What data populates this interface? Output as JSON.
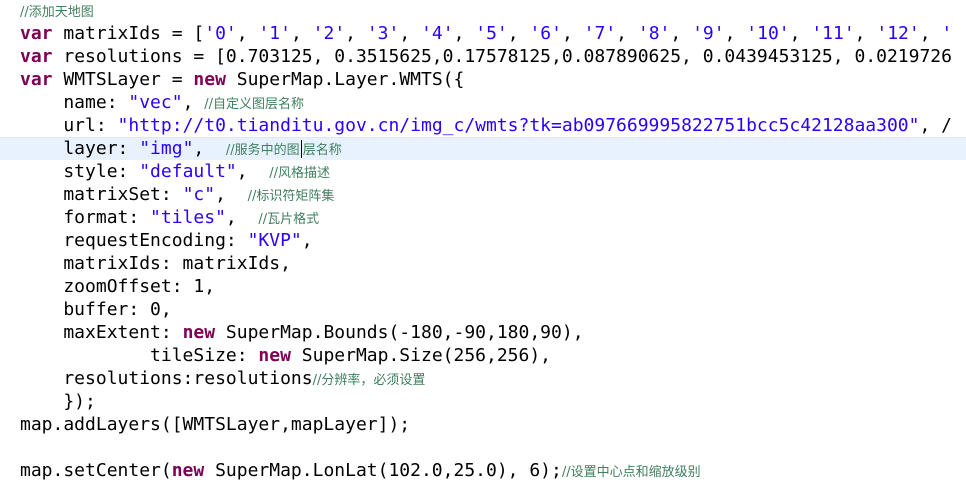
{
  "editor": {
    "current_line_index": 6,
    "lines": [
      [
        {
          "t": "cm",
          "v": "//添加天地图"
        }
      ],
      [
        {
          "t": "kw",
          "v": "var"
        },
        {
          "t": "pl",
          "v": " matrixIds = ["
        },
        {
          "t": "str",
          "v": "'0'"
        },
        {
          "t": "pl",
          "v": ", "
        },
        {
          "t": "str",
          "v": "'1'"
        },
        {
          "t": "pl",
          "v": ", "
        },
        {
          "t": "str",
          "v": "'2'"
        },
        {
          "t": "pl",
          "v": ", "
        },
        {
          "t": "str",
          "v": "'3'"
        },
        {
          "t": "pl",
          "v": ", "
        },
        {
          "t": "str",
          "v": "'4'"
        },
        {
          "t": "pl",
          "v": ", "
        },
        {
          "t": "str",
          "v": "'5'"
        },
        {
          "t": "pl",
          "v": ", "
        },
        {
          "t": "str",
          "v": "'6'"
        },
        {
          "t": "pl",
          "v": ", "
        },
        {
          "t": "str",
          "v": "'7'"
        },
        {
          "t": "pl",
          "v": ", "
        },
        {
          "t": "str",
          "v": "'8'"
        },
        {
          "t": "pl",
          "v": ", "
        },
        {
          "t": "str",
          "v": "'9'"
        },
        {
          "t": "pl",
          "v": ", "
        },
        {
          "t": "str",
          "v": "'10'"
        },
        {
          "t": "pl",
          "v": ", "
        },
        {
          "t": "str",
          "v": "'11'"
        },
        {
          "t": "pl",
          "v": ", "
        },
        {
          "t": "str",
          "v": "'12'"
        },
        {
          "t": "pl",
          "v": ", "
        },
        {
          "t": "str",
          "v": "'"
        }
      ],
      [
        {
          "t": "kw",
          "v": "var"
        },
        {
          "t": "pl",
          "v": " resolutions = [0.703125, 0.3515625,0.17578125,0.087890625, 0.0439453125, 0.0219726"
        }
      ],
      [
        {
          "t": "kw",
          "v": "var"
        },
        {
          "t": "pl",
          "v": " WMTSLayer = "
        },
        {
          "t": "kw",
          "v": "new"
        },
        {
          "t": "pl",
          "v": " SuperMap.Layer.WMTS({"
        }
      ],
      [
        {
          "t": "pl",
          "v": "    name: "
        },
        {
          "t": "str",
          "v": "\"vec\""
        },
        {
          "t": "pl",
          "v": ", "
        },
        {
          "t": "cm",
          "v": "//自定义图层名称"
        }
      ],
      [
        {
          "t": "pl",
          "v": "    url: "
        },
        {
          "t": "str",
          "v": "\"http://t0.tianditu.gov.cn/img_c/wmts?tk=ab097669995822751bcc5c42128aa300\""
        },
        {
          "t": "pl",
          "v": ", /"
        }
      ],
      [
        {
          "t": "pl",
          "v": "    layer: "
        },
        {
          "t": "str",
          "v": "\"img\""
        },
        {
          "t": "pl",
          "v": ",  "
        },
        {
          "t": "cm",
          "v": "//服务中的图"
        },
        {
          "t": "caret",
          "v": ""
        },
        {
          "t": "cm",
          "v": "层名称"
        }
      ],
      [
        {
          "t": "pl",
          "v": "    style: "
        },
        {
          "t": "str",
          "v": "\"default\""
        },
        {
          "t": "pl",
          "v": ",  "
        },
        {
          "t": "cm",
          "v": "//风格描述"
        }
      ],
      [
        {
          "t": "pl",
          "v": "    matrixSet: "
        },
        {
          "t": "str",
          "v": "\"c\""
        },
        {
          "t": "pl",
          "v": ",  "
        },
        {
          "t": "cm",
          "v": "//标识符矩阵集"
        }
      ],
      [
        {
          "t": "pl",
          "v": "    format: "
        },
        {
          "t": "str",
          "v": "\"tiles\""
        },
        {
          "t": "pl",
          "v": ",  "
        },
        {
          "t": "cm",
          "v": "//瓦片格式"
        }
      ],
      [
        {
          "t": "pl",
          "v": "    requestEncoding: "
        },
        {
          "t": "str",
          "v": "\"KVP\""
        },
        {
          "t": "pl",
          "v": ","
        }
      ],
      [
        {
          "t": "pl",
          "v": "    matrixIds: matrixIds,"
        }
      ],
      [
        {
          "t": "pl",
          "v": "    zoomOffset: 1,"
        }
      ],
      [
        {
          "t": "pl",
          "v": "    buffer: 0,"
        }
      ],
      [
        {
          "t": "pl",
          "v": "    maxExtent: "
        },
        {
          "t": "kw",
          "v": "new"
        },
        {
          "t": "pl",
          "v": " SuperMap.Bounds(-180,-90,180,90),"
        }
      ],
      [
        {
          "t": "pl",
          "v": "            tileSize: "
        },
        {
          "t": "kw",
          "v": "new"
        },
        {
          "t": "pl",
          "v": " SuperMap.Size(256,256),"
        }
      ],
      [
        {
          "t": "pl",
          "v": "    resolutions:resolutions"
        },
        {
          "t": "cm",
          "v": "//分辨率，必须设置"
        }
      ],
      [
        {
          "t": "pl",
          "v": "    });"
        }
      ],
      [
        {
          "t": "pl",
          "v": "map.addLayers([WMTSLayer,mapLayer]);"
        }
      ],
      [],
      [
        {
          "t": "pl",
          "v": "map.setCenter("
        },
        {
          "t": "kw",
          "v": "new"
        },
        {
          "t": "pl",
          "v": " SuperMap.LonLat(102.0,25.0), 6);"
        },
        {
          "t": "cm",
          "v": "//设置中心点和缩放级别"
        }
      ]
    ]
  }
}
